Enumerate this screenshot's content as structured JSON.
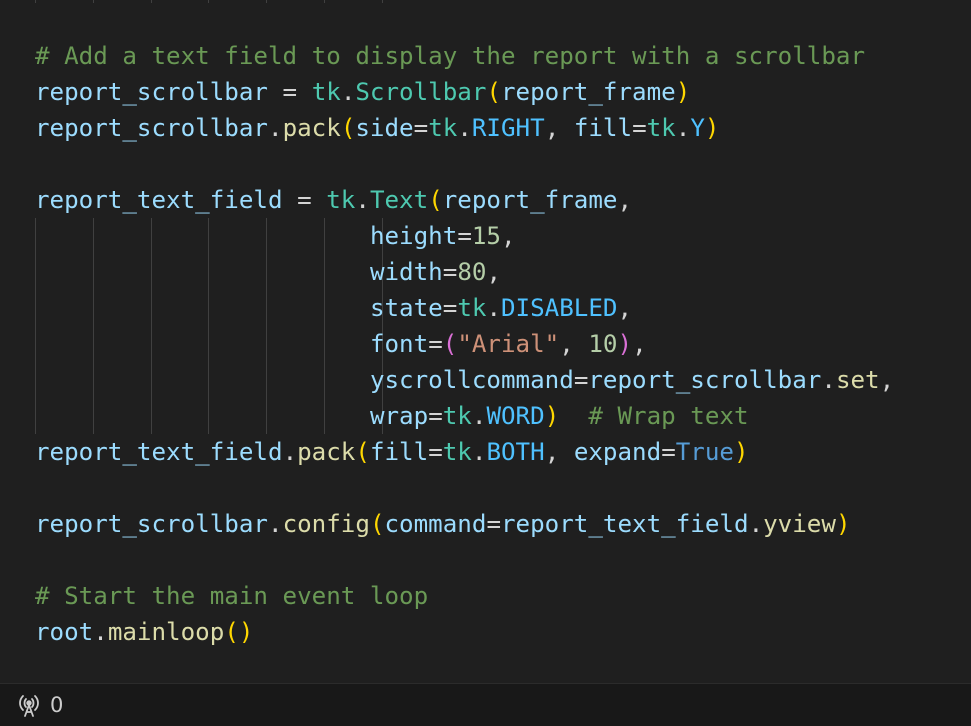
{
  "colors": {
    "background": "#1f1f1f",
    "comment": "#6a9955",
    "variable": "#9cdcfe",
    "module": "#4ec9b0",
    "function": "#dcdcaa",
    "constant": "#4fc1ff",
    "number": "#b5cea8",
    "string": "#ce9178",
    "keyword": "#569cd6",
    "bracket_1": "#ffd700",
    "bracket_2": "#da70d6",
    "operator": "#d4d4d4",
    "indent_guide": "#404040",
    "statusbar_background": "#181818",
    "statusbar_foreground": "#cccccc"
  },
  "code_lines": [
    [],
    [
      [
        "comment",
        "# Add a text field to display the report with a scrollbar"
      ]
    ],
    [
      [
        "variable",
        "report_scrollbar"
      ],
      [
        "operator",
        " = "
      ],
      [
        "module",
        "tk"
      ],
      [
        "operator",
        "."
      ],
      [
        "module",
        "Scrollbar"
      ],
      [
        "bracket_1",
        "("
      ],
      [
        "variable",
        "report_frame"
      ],
      [
        "bracket_1",
        ")"
      ]
    ],
    [
      [
        "variable",
        "report_scrollbar"
      ],
      [
        "operator",
        "."
      ],
      [
        "function",
        "pack"
      ],
      [
        "bracket_1",
        "("
      ],
      [
        "variable",
        "side"
      ],
      [
        "operator",
        "="
      ],
      [
        "module",
        "tk"
      ],
      [
        "operator",
        "."
      ],
      [
        "constant",
        "RIGHT"
      ],
      [
        "operator",
        ", "
      ],
      [
        "variable",
        "fill"
      ],
      [
        "operator",
        "="
      ],
      [
        "module",
        "tk"
      ],
      [
        "operator",
        "."
      ],
      [
        "constant",
        "Y"
      ],
      [
        "bracket_1",
        ")"
      ]
    ],
    [],
    [
      [
        "variable",
        "report_text_field"
      ],
      [
        "operator",
        " = "
      ],
      [
        "module",
        "tk"
      ],
      [
        "operator",
        "."
      ],
      [
        "module",
        "Text"
      ],
      [
        "bracket_1",
        "("
      ],
      [
        "variable",
        "report_frame"
      ],
      [
        "operator",
        ","
      ]
    ],
    [
      [
        "operator",
        "                       "
      ],
      [
        "variable",
        "height"
      ],
      [
        "operator",
        "="
      ],
      [
        "number",
        "15"
      ],
      [
        "operator",
        ","
      ]
    ],
    [
      [
        "operator",
        "                       "
      ],
      [
        "variable",
        "width"
      ],
      [
        "operator",
        "="
      ],
      [
        "number",
        "80"
      ],
      [
        "operator",
        ","
      ]
    ],
    [
      [
        "operator",
        "                       "
      ],
      [
        "variable",
        "state"
      ],
      [
        "operator",
        "="
      ],
      [
        "module",
        "tk"
      ],
      [
        "operator",
        "."
      ],
      [
        "constant",
        "DISABLED"
      ],
      [
        "operator",
        ","
      ]
    ],
    [
      [
        "operator",
        "                       "
      ],
      [
        "variable",
        "font"
      ],
      [
        "operator",
        "="
      ],
      [
        "bracket_2",
        "("
      ],
      [
        "string",
        "\"Arial\""
      ],
      [
        "operator",
        ", "
      ],
      [
        "number",
        "10"
      ],
      [
        "bracket_2",
        ")"
      ],
      [
        "operator",
        ","
      ]
    ],
    [
      [
        "operator",
        "                       "
      ],
      [
        "variable",
        "yscrollcommand"
      ],
      [
        "operator",
        "="
      ],
      [
        "variable",
        "report_scrollbar"
      ],
      [
        "operator",
        "."
      ],
      [
        "function",
        "set"
      ],
      [
        "operator",
        ","
      ]
    ],
    [
      [
        "operator",
        "                       "
      ],
      [
        "variable",
        "wrap"
      ],
      [
        "operator",
        "="
      ],
      [
        "module",
        "tk"
      ],
      [
        "operator",
        "."
      ],
      [
        "constant",
        "WORD"
      ],
      [
        "bracket_1",
        ")"
      ],
      [
        "operator",
        "  "
      ],
      [
        "comment",
        "# Wrap text"
      ]
    ],
    [
      [
        "variable",
        "report_text_field"
      ],
      [
        "operator",
        "."
      ],
      [
        "function",
        "pack"
      ],
      [
        "bracket_1",
        "("
      ],
      [
        "variable",
        "fill"
      ],
      [
        "operator",
        "="
      ],
      [
        "module",
        "tk"
      ],
      [
        "operator",
        "."
      ],
      [
        "constant",
        "BOTH"
      ],
      [
        "operator",
        ", "
      ],
      [
        "variable",
        "expand"
      ],
      [
        "operator",
        "="
      ],
      [
        "keyword",
        "True"
      ],
      [
        "bracket_1",
        ")"
      ]
    ],
    [],
    [
      [
        "variable",
        "report_scrollbar"
      ],
      [
        "operator",
        "."
      ],
      [
        "function",
        "config"
      ],
      [
        "bracket_1",
        "("
      ],
      [
        "variable",
        "command"
      ],
      [
        "operator",
        "="
      ],
      [
        "variable",
        "report_text_field"
      ],
      [
        "operator",
        "."
      ],
      [
        "function",
        "yview"
      ],
      [
        "bracket_1",
        ")"
      ]
    ],
    [],
    [
      [
        "comment",
        "# Start the main event loop"
      ]
    ],
    [
      [
        "variable",
        "root"
      ],
      [
        "operator",
        "."
      ],
      [
        "function",
        "mainloop"
      ],
      [
        "bracket_1",
        "()"
      ]
    ]
  ],
  "statusbar": {
    "icon": "broadcast-icon",
    "ports_count": "0"
  }
}
